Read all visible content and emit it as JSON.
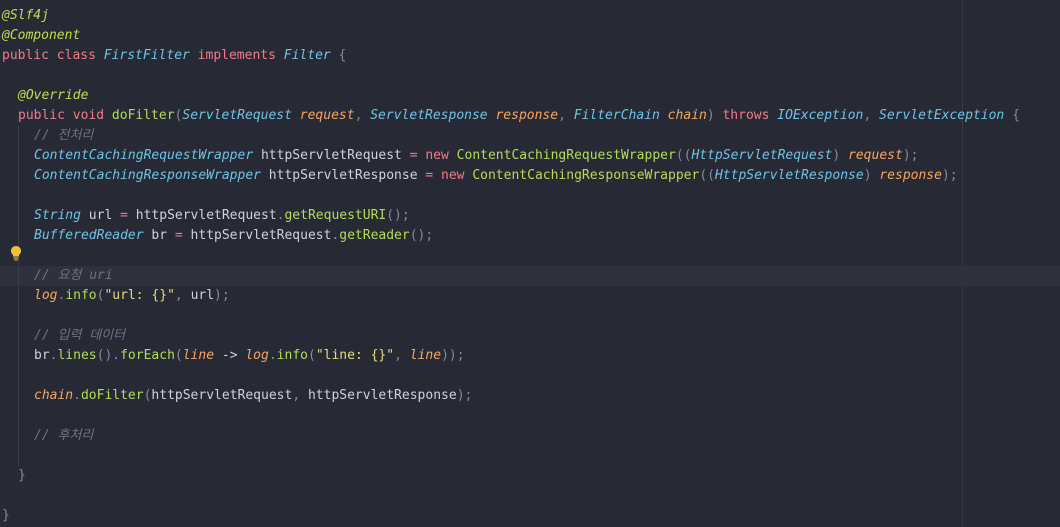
{
  "theme": {
    "background": "#272a34",
    "current_line": "#2f323d",
    "annotation": "#c6dd4c",
    "keyword": "#f27a8a",
    "type": "#6cc4e6",
    "function": "#b5dd53",
    "parameter": "#f8a65c",
    "comment": "#6d7382",
    "string": "#e6dd73"
  },
  "gutter_icon": "lightbulb-icon",
  "code": {
    "l1": {
      "ann": "@Slf4j"
    },
    "l2": {
      "ann": "@Component"
    },
    "l3": {
      "kw": "public class ",
      "cls": "FirstFilter",
      "kw2": " implements ",
      "iface": "Filter",
      "brace": " {"
    },
    "l5": {
      "ann": "@Override"
    },
    "l6": {
      "kw": "public void ",
      "fn": "doFilter",
      "p1": "(",
      "t1": "ServletRequest",
      "v1": " request",
      "c1": ", ",
      "t2": "ServletResponse",
      "v2": " response",
      "c2": ", ",
      "t3": "FilterChain",
      "v3": " chain",
      "p2": ") ",
      "kw2": "throws ",
      "t4": "IOException",
      "c3": ", ",
      "t5": "ServletException",
      "brace": " {"
    },
    "l7": {
      "cmt": "// 전처리"
    },
    "l8": {
      "t1": "ContentCachingRequestWrapper",
      "var": " httpServletRequest ",
      "op": "= ",
      "kw": "new ",
      "fn": "ContentCachingRequestWrapper",
      "p1": "((",
      "t2": "HttpServletRequest",
      "p2": ") ",
      "v": "request",
      "p3": ");"
    },
    "l9": {
      "t1": "ContentCachingResponseWrapper",
      "var": " httpServletResponse ",
      "op": "= ",
      "kw": "new ",
      "fn": "ContentCachingResponseWrapper",
      "p1": "((",
      "t2": "HttpServletResponse",
      "p2": ") ",
      "v": "response",
      "p3": ");"
    },
    "l11": {
      "t1": "String",
      "var": " url ",
      "op": "= ",
      "obj": "httpServletRequest",
      "dot": ".",
      "fn": "getRequestURI",
      "p": "();"
    },
    "l12": {
      "t1": "BufferedReader",
      "var": " br ",
      "op": "= ",
      "obj": "httpServletRequest",
      "dot": ".",
      "fn": "getReader",
      "p": "();"
    },
    "l14": {
      "cmt": "// 요청 uri"
    },
    "l15": {
      "obj": "log",
      "dot": ".",
      "fn": "info",
      "p1": "(",
      "str": "\"url: {}\"",
      "c": ", ",
      "arg": "url",
      "p2": ");"
    },
    "l17": {
      "cmt": "// 입력 데이터"
    },
    "l18": {
      "obj": "br",
      "dot1": ".",
      "fn1": "lines",
      "p1": "()",
      "dot2": ".",
      "fn2": "forEach",
      "p2": "(",
      "v1": "line",
      "arrow": " -> ",
      "obj2": "log",
      "dot3": ".",
      "fn3": "info",
      "p3": "(",
      "str": "\"line: {}\"",
      "c": ", ",
      "v2": "line",
      "p4": "));"
    },
    "l20": {
      "obj": "chain",
      "dot": ".",
      "fn": "doFilter",
      "p1": "(",
      "a1": "httpServletRequest",
      "c": ", ",
      "a2": "httpServletResponse",
      "p2": ");"
    },
    "l22": {
      "cmt": "// 후처리"
    },
    "l24": {
      "brace": "}"
    },
    "l26": {
      "brace": "}"
    }
  }
}
